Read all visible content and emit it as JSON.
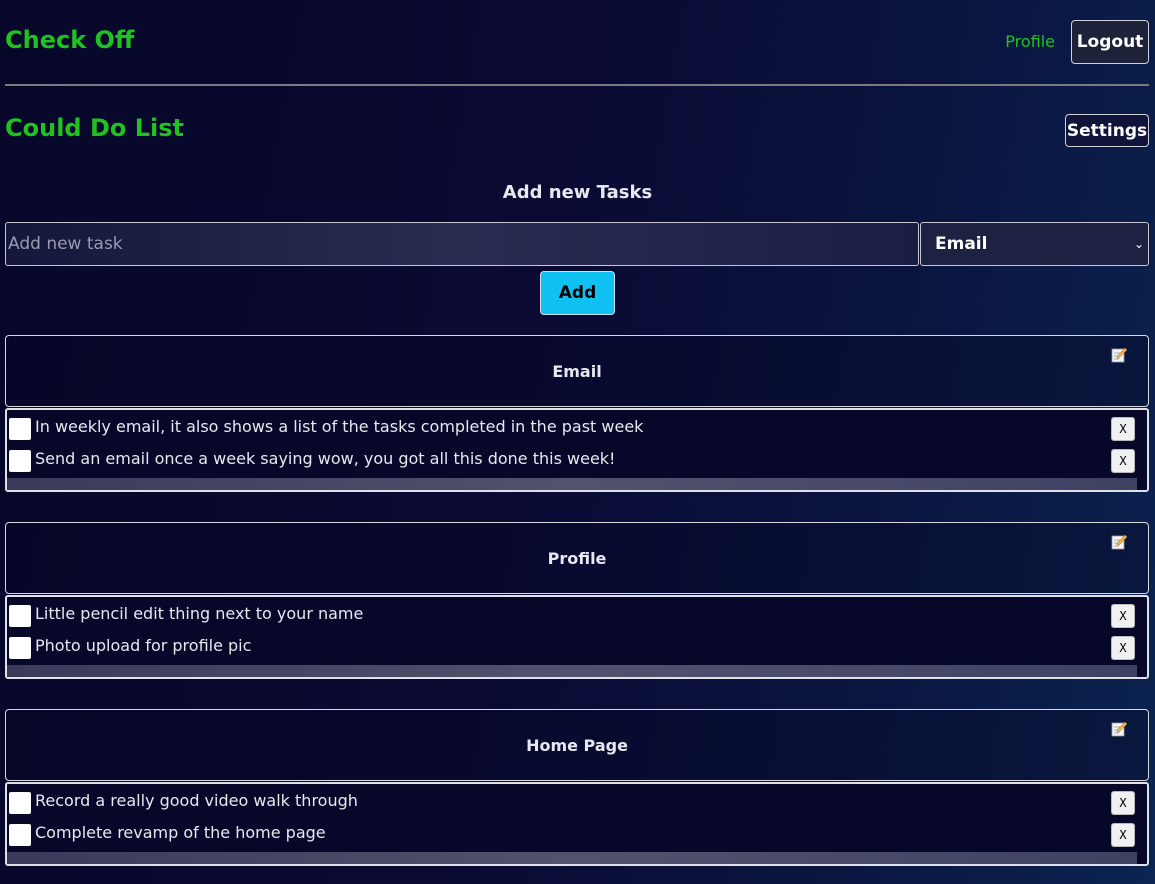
{
  "app": {
    "brand": "Check Off",
    "profile_link": "Profile",
    "logout_label": "Logout"
  },
  "list": {
    "title": "Could Do List",
    "settings_label": "Settings"
  },
  "add_form": {
    "heading": "Add new Tasks",
    "placeholder": "Add new task",
    "selected_category": "Email",
    "add_label": "Add"
  },
  "categories": [
    {
      "name": "Email",
      "tasks": [
        {
          "text": "In weekly email, it also shows a list of the tasks completed in the past week",
          "delete_label": "X"
        },
        {
          "text": "Send an email once a week saying wow, you got all this done this week!",
          "delete_label": "X"
        }
      ]
    },
    {
      "name": "Profile",
      "tasks": [
        {
          "text": "Little pencil edit thing next to your name",
          "delete_label": "X"
        },
        {
          "text": "Photo upload for profile pic",
          "delete_label": "X"
        }
      ]
    },
    {
      "name": "Home Page",
      "tasks": [
        {
          "text": "Record a really good video walk through",
          "delete_label": "X"
        },
        {
          "text": "Complete revamp of the home page",
          "delete_label": "X"
        }
      ]
    }
  ],
  "icons": {
    "edit": "pencil-memo-icon",
    "select": "chevron-down-icon"
  },
  "colors": {
    "brand": "#1fc21f",
    "add_button": "#10c0f0"
  }
}
